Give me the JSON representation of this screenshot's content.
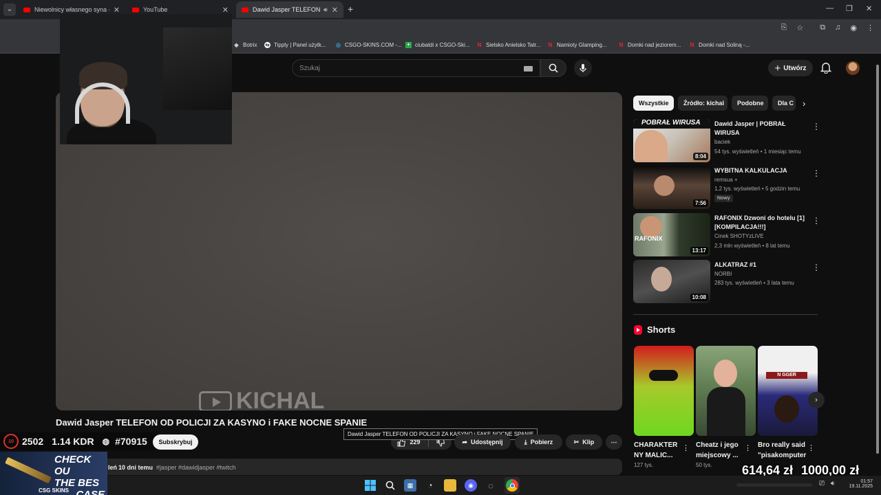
{
  "browser": {
    "tabs": [
      {
        "label": "Niewolnicy własnego syna - Sp"
      },
      {
        "label": "YouTube"
      },
      {
        "label": "Dawid Jasper TELEFON OD"
      }
    ],
    "bookmarks": [
      {
        "label": "Botrix"
      },
      {
        "label": "Tipply | Panel użytk..."
      },
      {
        "label": "CSGO-SKINS.COM -..."
      },
      {
        "label": "ciubaldi x CSGO-Ski..."
      },
      {
        "label": "Sielsko Anielsko Tatr..."
      },
      {
        "label": "Namioty Glamping..."
      },
      {
        "label": "Domki nad jeziorem..."
      },
      {
        "label": "Domki nad Soliną -..."
      }
    ]
  },
  "header": {
    "search_placeholder": "Szukaj",
    "create_label": "Utwórz"
  },
  "video": {
    "watermark": "KICHAL",
    "title": "Dawid Jasper TELEFON OD POLICJI ZA KASYNO i FAKE NOCNE SPANIE",
    "tooltip": "Dawid Jasper TELEFON OD POLICJI ZA KASYNO i FAKE NOCNE SPANIE",
    "subscribe_label": "Subskrybuj",
    "likes": "229",
    "share_label": "Udostępnij",
    "download_label": "Pobierz",
    "clip_label": "Klip",
    "desc_views_fragment": "leń",
    "desc_date": "10 dni temu",
    "desc_tags": "#jasper #dawidjasper #twitch"
  },
  "stats_overlay": {
    "level": "10",
    "elo": "2502",
    "kdr": "1.14 KDR",
    "rank": "#70915"
  },
  "ad": {
    "line1": "CHECK OU",
    "line2": "THE BES",
    "line3": "CASE",
    "brand": "CSG SKINS"
  },
  "sidebar": {
    "chips": [
      "Wszystkie",
      "Źródło: kichal",
      "Podobne",
      "Dla C"
    ],
    "recs": [
      {
        "title": "Dawid Jasper | POBRAŁ WIRUSA",
        "channel": "baciek",
        "meta": "54 tys. wyświetleń • 1 miesiąc temu",
        "duration": "8:04",
        "thumb_text": "POBRAŁ WIRUSA"
      },
      {
        "title": "WYBITNA KALKULACJA",
        "channel": "remsua +",
        "meta": "1,2 tys. wyświetleń • 5 godzin temu",
        "badge": "Nowy",
        "duration": "7:56"
      },
      {
        "title": "RAFONIX Dzwoni do hotelu [1] [KOMPILACJA!!!]",
        "channel": "Cinek SHOTYzLIVE",
        "meta": "2,3 mln wyświetleń • 8 lat temu",
        "duration": "13:17",
        "thumb_text": "RAFONIX"
      },
      {
        "title": "ALKATRAZ #1",
        "channel": "NORBI",
        "meta": "283 tys. wyświetleń • 3 lata temu",
        "duration": "10:08"
      }
    ],
    "shorts_heading": "Shorts",
    "shorts": [
      {
        "title": "CHARAKTER NY MALIC...",
        "views": "127 tys."
      },
      {
        "title": "Cheatz i jego miejscowy ...",
        "views": "50 tys."
      },
      {
        "title": "Bro really said \"pisakomputer",
        "views": ""
      }
    ],
    "shorts3_thumb_text": "N GGER"
  },
  "money": {
    "left": "614,64 zł",
    "right": "1000,00 zł"
  },
  "system": {
    "time": "01:57",
    "date": "19.11.2025"
  }
}
